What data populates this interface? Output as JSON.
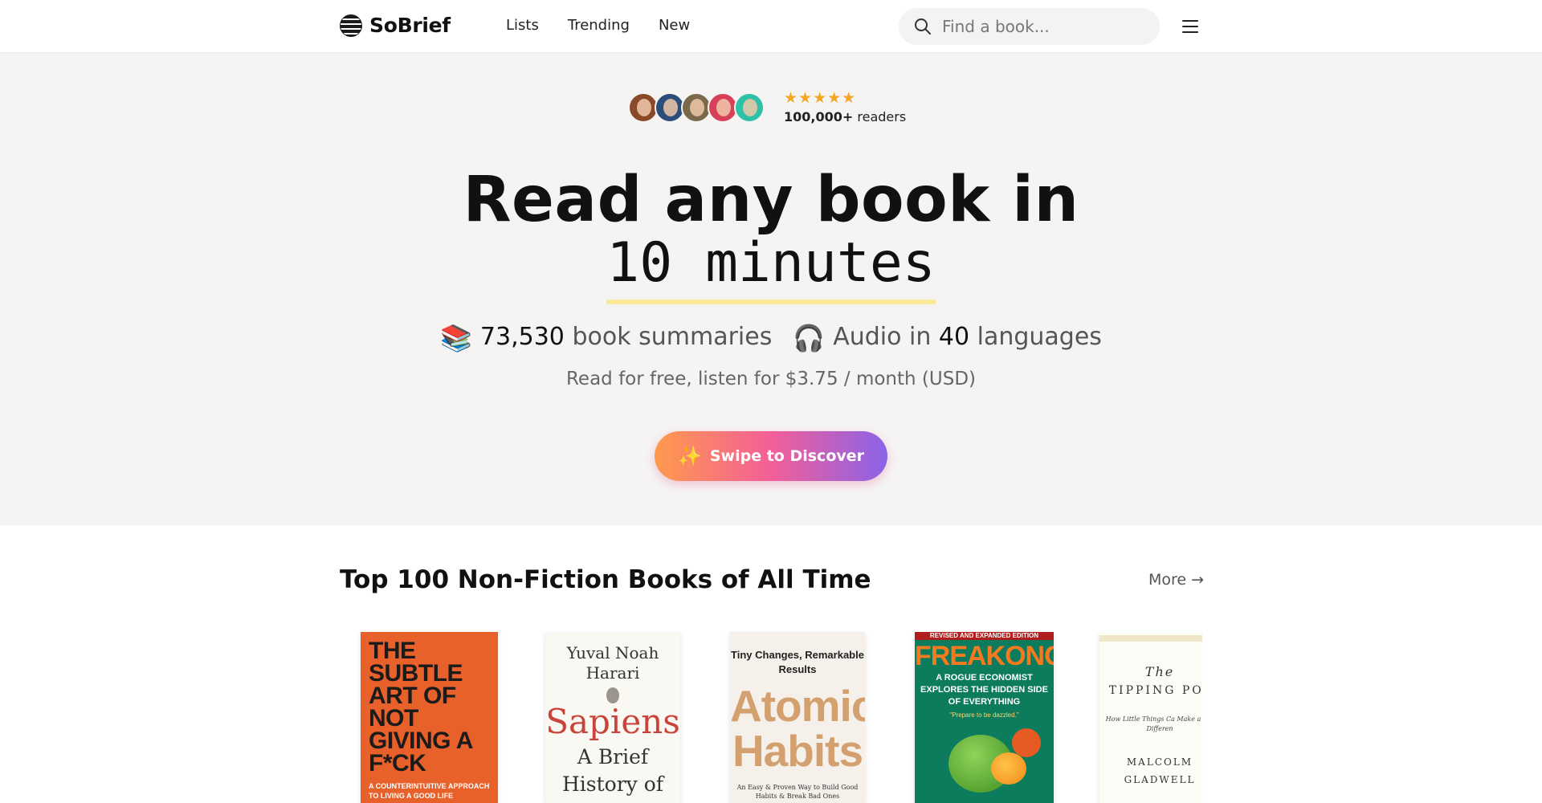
{
  "header": {
    "brand": "SoBrief",
    "nav": [
      "Lists",
      "Trending",
      "New"
    ],
    "search_placeholder": "Find a book..."
  },
  "hero": {
    "stars": "★★★★★",
    "readers_count": "100,000+",
    "readers_label": "readers",
    "title_line1": "Read any book in",
    "title_line2": "10 minutes",
    "summaries_count": "73,530",
    "summaries_label": "book summaries",
    "audio_prefix": "Audio in",
    "languages_count": "40",
    "languages_label": "languages",
    "pricing": "Read for free, listen for $3.75 / month (USD)",
    "cta_label": "Swipe to Discover"
  },
  "section": {
    "title": "Top 100 Non-Fiction Books of All Time",
    "more_label": "More →"
  },
  "books": [
    {
      "cover_title": "THE SUBTLE ART OF NOT GIVING A F*CK",
      "cover_subtitle": "A COUNTERINTUITIVE APPROACH TO LIVING A GOOD LIFE"
    },
    {
      "cover_author": "Yuval Noah Harari",
      "cover_title": "Sapiens",
      "cover_subtitle": "A Brief History of"
    },
    {
      "cover_tagline": "Tiny Changes, Remarkable Results",
      "cover_title": "Atomic Habits",
      "cover_subtitle": "An Easy & Proven Way to Build Good Habits & Break Bad Ones"
    },
    {
      "cover_band": "REVISED AND EXPANDED EDITION",
      "cover_title": "FREAKONOMICS",
      "cover_subtitle": "A ROGUE ECONOMIST EXPLORES THE HIDDEN SIDE OF EVERYTHING",
      "cover_quote": "\"Prepare to be dazzled.\""
    },
    {
      "cover_title_1": "The",
      "cover_title_2": "TIPPING POI",
      "cover_subtitle": "How Little Things Ca Make a Big Differen",
      "cover_author": "MALCOLM GLADWELL"
    }
  ],
  "colors": {
    "cta_gradient": [
      "#ff9a4d",
      "#f35f98",
      "#8a63e8"
    ],
    "hero_bg": "#f5f4f3",
    "underline": "#fde99a",
    "stars": "#f5a623"
  },
  "icons": [
    "logo-icon",
    "search-icon",
    "menu-icon",
    "books-emoji-icon",
    "headphones-emoji-icon",
    "sparkle-icon"
  ]
}
